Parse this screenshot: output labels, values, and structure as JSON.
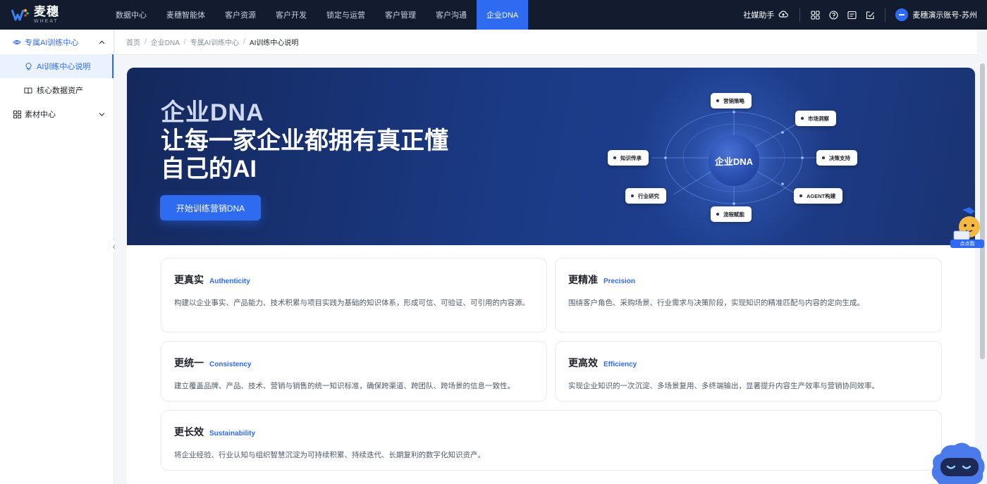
{
  "app": {
    "logo_cn": "麦穗",
    "logo_en": "WHEAT"
  },
  "nav": {
    "items": [
      {
        "label": "数据中心"
      },
      {
        "label": "麦穗智能体"
      },
      {
        "label": "客户资源"
      },
      {
        "label": "客户开发"
      },
      {
        "label": "锁定与运营"
      },
      {
        "label": "客户管理"
      },
      {
        "label": "客户沟通"
      },
      {
        "label": "企业DNA"
      }
    ],
    "active_index": 7
  },
  "topright": {
    "media_helper": "社媒助手",
    "account_name": "麦穗演示账号-苏州"
  },
  "sidebar": {
    "groups": [
      {
        "label": "专属AI训练中心",
        "expanded": true
      },
      {
        "label": "素材中心",
        "expanded": false
      }
    ],
    "subitems": [
      {
        "label": "AI训练中心说明"
      },
      {
        "label": "核心数据资产"
      }
    ]
  },
  "breadcrumb": {
    "items": [
      "首页",
      "企业DNA",
      "专属AI训练中心"
    ],
    "current": "AI训练中心说明"
  },
  "hero": {
    "title": "企业DNA",
    "subtitle": "让每一家企业都拥有真正懂自己的AI",
    "button": "开始训练营销DNA",
    "core_label": "企业DNA",
    "chips": [
      {
        "label": "营销策略"
      },
      {
        "label": "市场洞察"
      },
      {
        "label": "决策支持"
      },
      {
        "label": "AGENT构建"
      },
      {
        "label": "流程赋能"
      },
      {
        "label": "行业研究"
      },
      {
        "label": "知识传承"
      }
    ]
  },
  "cards": [
    {
      "title": "更真实",
      "en": "Authenticity",
      "desc": "构建以企业事实、产品能力、技术积累与项目实践为基础的知识体系，形成可信、可验证、可引用的内容源。"
    },
    {
      "title": "更精准",
      "en": "Precision",
      "desc": "围绕客户角色、采购场景、行业需求与决策阶段，实现知识的精准匹配与内容的定向生成。"
    },
    {
      "title": "更统一",
      "en": "Consistency",
      "desc": "建立覆盖品牌、产品、技术、营销与销售的统一知识标准，确保跨渠道、跨团队、跨场景的信息一致性。"
    },
    {
      "title": "更高效",
      "en": "Efficiency",
      "desc": "实现企业知识的一次沉淀、多场景复用、多终端输出，显著提升内容生产效率与营销协同效率。"
    },
    {
      "title": "更长效",
      "en": "Sustainability",
      "desc": "将企业经验、行业认知与组织智慧沉淀为可持续积累、持续迭代、长期复利的数字化知识资产。"
    }
  ],
  "mascot": {
    "label": "点点我"
  },
  "colors": {
    "accent": "#2f6bf0",
    "topbar": "#131c2e",
    "hero_bg": "#1b3a85"
  }
}
